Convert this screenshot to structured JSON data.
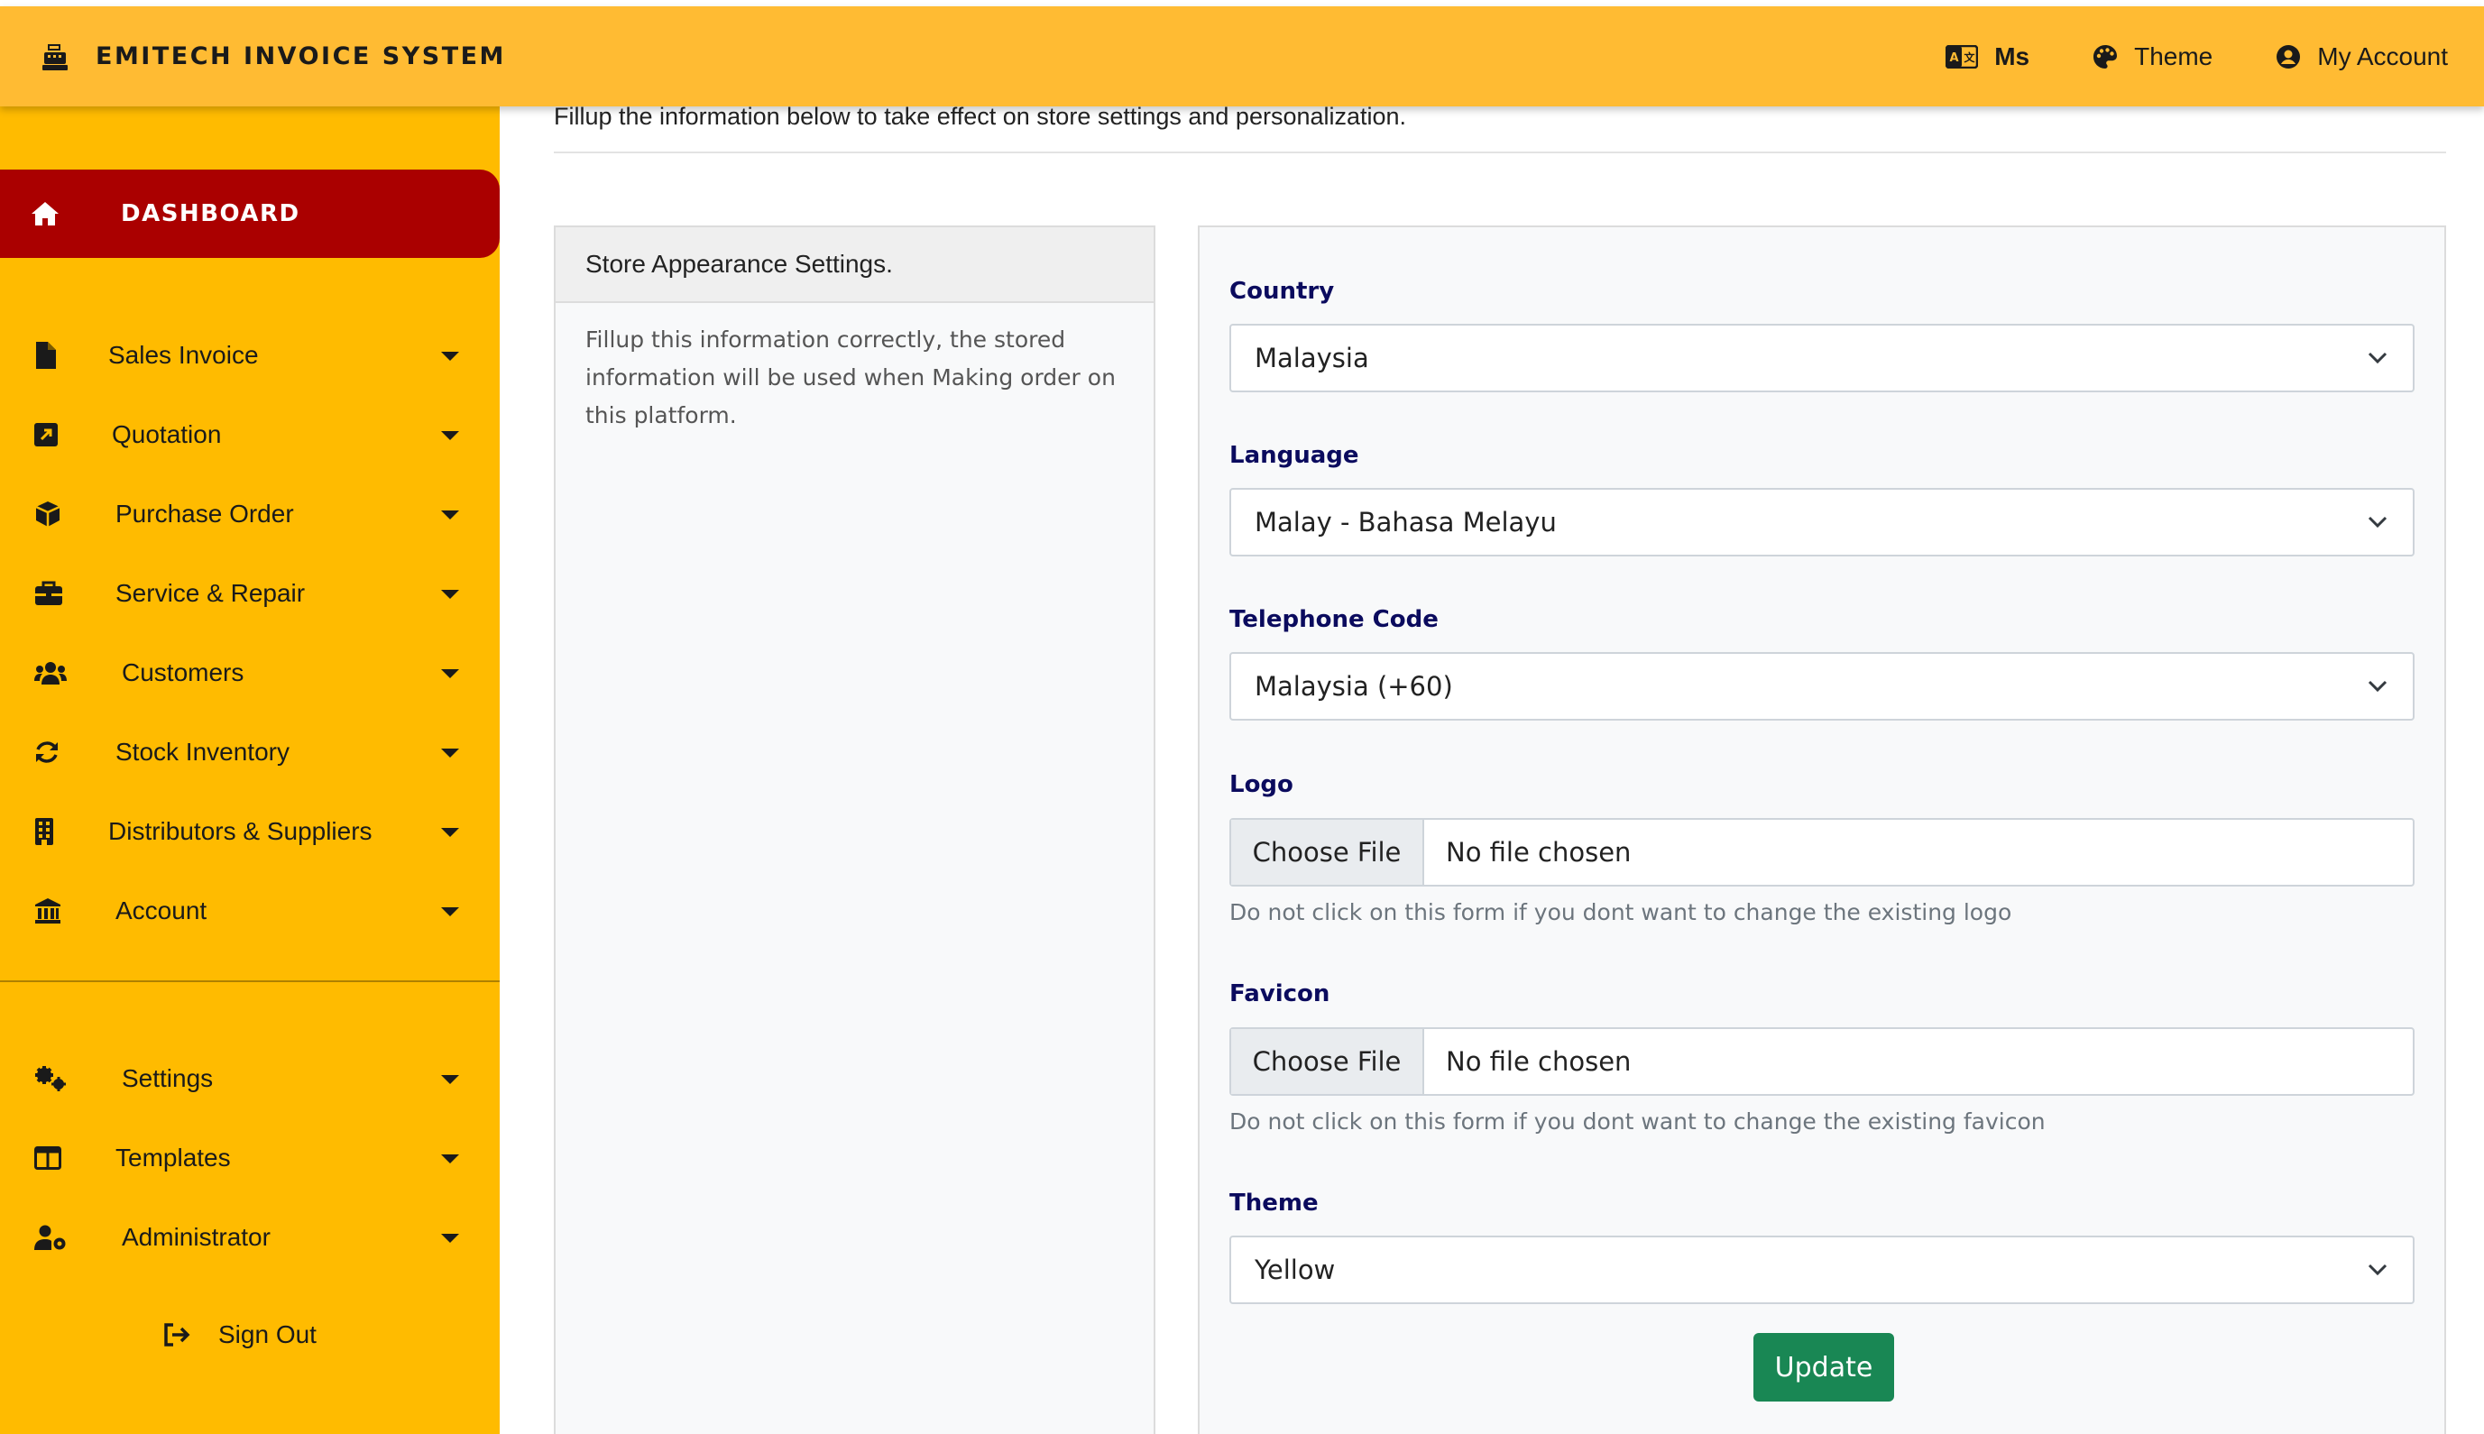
{
  "header": {
    "brand_title": "EMITECH INVOICE SYSTEM",
    "language_short": "Ms",
    "theme_label": "Theme",
    "account_label": "My Account",
    "bar_color": "#ffbb33"
  },
  "sidebar": {
    "dashboard_label": "DASHBOARD",
    "items": [
      {
        "label": "Sales Invoice",
        "icon": "file-icon"
      },
      {
        "label": "Quotation",
        "icon": "quote-icon"
      },
      {
        "label": "Purchase Order",
        "icon": "box-icon"
      },
      {
        "label": "Service & Repair",
        "icon": "toolbox-icon"
      },
      {
        "label": "Customers",
        "icon": "users-icon"
      },
      {
        "label": "Stock Inventory",
        "icon": "sync-icon"
      },
      {
        "label": "Distributors & Suppliers",
        "icon": "building-icon"
      },
      {
        "label": "Account",
        "icon": "bank-icon"
      }
    ],
    "bottom_items": [
      {
        "label": "Settings",
        "icon": "gears-icon"
      },
      {
        "label": "Templates",
        "icon": "columns-icon"
      },
      {
        "label": "Administrator",
        "icon": "user-cog-icon"
      }
    ],
    "sign_out_label": "Sign Out",
    "bg_color": "#ffbb00",
    "active_color": "#aa0000"
  },
  "main": {
    "intro": "Fillup the information below to take effect on store settings and personalization.",
    "left_card": {
      "title": "Store Appearance Settings.",
      "body": "Fillup this information correctly, the stored information will be used when Making order on this platform."
    },
    "form": {
      "country_label": "Country",
      "country_value": "Malaysia",
      "language_label": "Language",
      "language_value": "Malay - Bahasa Melayu",
      "telephone_label": "Telephone Code",
      "telephone_value": "Malaysia (+60)",
      "logo_label": "Logo",
      "choose_file": "Choose File",
      "no_file": "No file chosen",
      "logo_help": "Do not click on this form if you dont want to change the existing logo",
      "favicon_label": "Favicon",
      "favicon_help": "Do not click on this form if you dont want to change the existing favicon",
      "theme_label": "Theme",
      "theme_value": "Yellow",
      "update_label": "Update",
      "update_color": "#198754"
    }
  }
}
